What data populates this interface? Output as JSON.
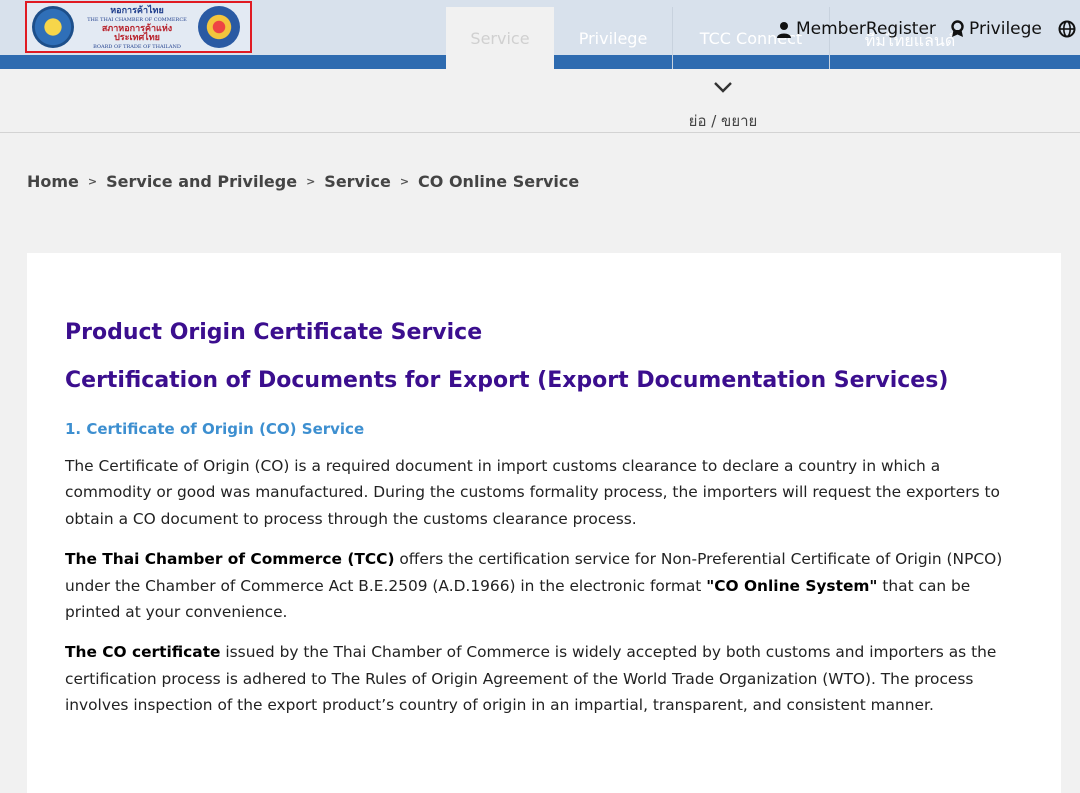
{
  "header": {
    "logo": {
      "thai_line_1": "หอการค้าไทย",
      "english_line_1": "THE THAI CHAMBER OF COMMERCE",
      "thai_line_2": "สภาหอการค้าแห่งประเทศไทย",
      "english_line_2": "BOARD OF TRADE OF THAILAND"
    },
    "nav_tabs": [
      {
        "label": "Service",
        "active": true
      },
      {
        "label": "Privilege"
      },
      {
        "label": "TCC Connect"
      },
      {
        "label": "ทีมไทยแลนด์"
      }
    ],
    "top_links": {
      "member_register": "MemberRegister",
      "privilege": "Privilege"
    }
  },
  "collapse": {
    "label": "ย่อ / ขยาย"
  },
  "breadcrumb": [
    "Home",
    "Service and Privilege",
    "Service",
    "CO Online Service"
  ],
  "content": {
    "title": "Product Origin Certificate Service",
    "subtitle": "Certification of Documents for Export (Export Documentation Services)",
    "section_heading": "1. Certificate of Origin (CO) Service",
    "para1": "The Certificate of Origin (CO) is a required document in import customs clearance to declare a country in which a commodity or good was manufactured. During the customs formality process, the importers will request the exporters to obtain a CO document to process through the customs clearance process.",
    "para2_bold1": "The Thai Chamber of Commerce (TCC)",
    "para2_text1": " offers the certification service for Non-Preferential Certificate of Origin (NPCO) under the Chamber of Commerce Act B.E.2509 (A.D.1966) in the electronic format ",
    "para2_bold2": "\"CO Online System\"",
    "para2_text2": " that can be printed at your convenience.",
    "para3_bold": "The CO certificate",
    "para3_text": " issued by the Thai Chamber of Commerce is widely accepted by both customs and importers as the certification process is adhered to The Rules of Origin Agreement of the World Trade Organization (WTO). The process involves inspection of the export product’s country of origin in an impartial, transparent, and consistent manner."
  },
  "colors": {
    "nav_blue": "#2e6bb0",
    "header_bg": "#d8e1ec",
    "title_purple": "#3b0e8e",
    "section_blue": "#3d8fd0",
    "logo_highlight": "#e01a22"
  }
}
